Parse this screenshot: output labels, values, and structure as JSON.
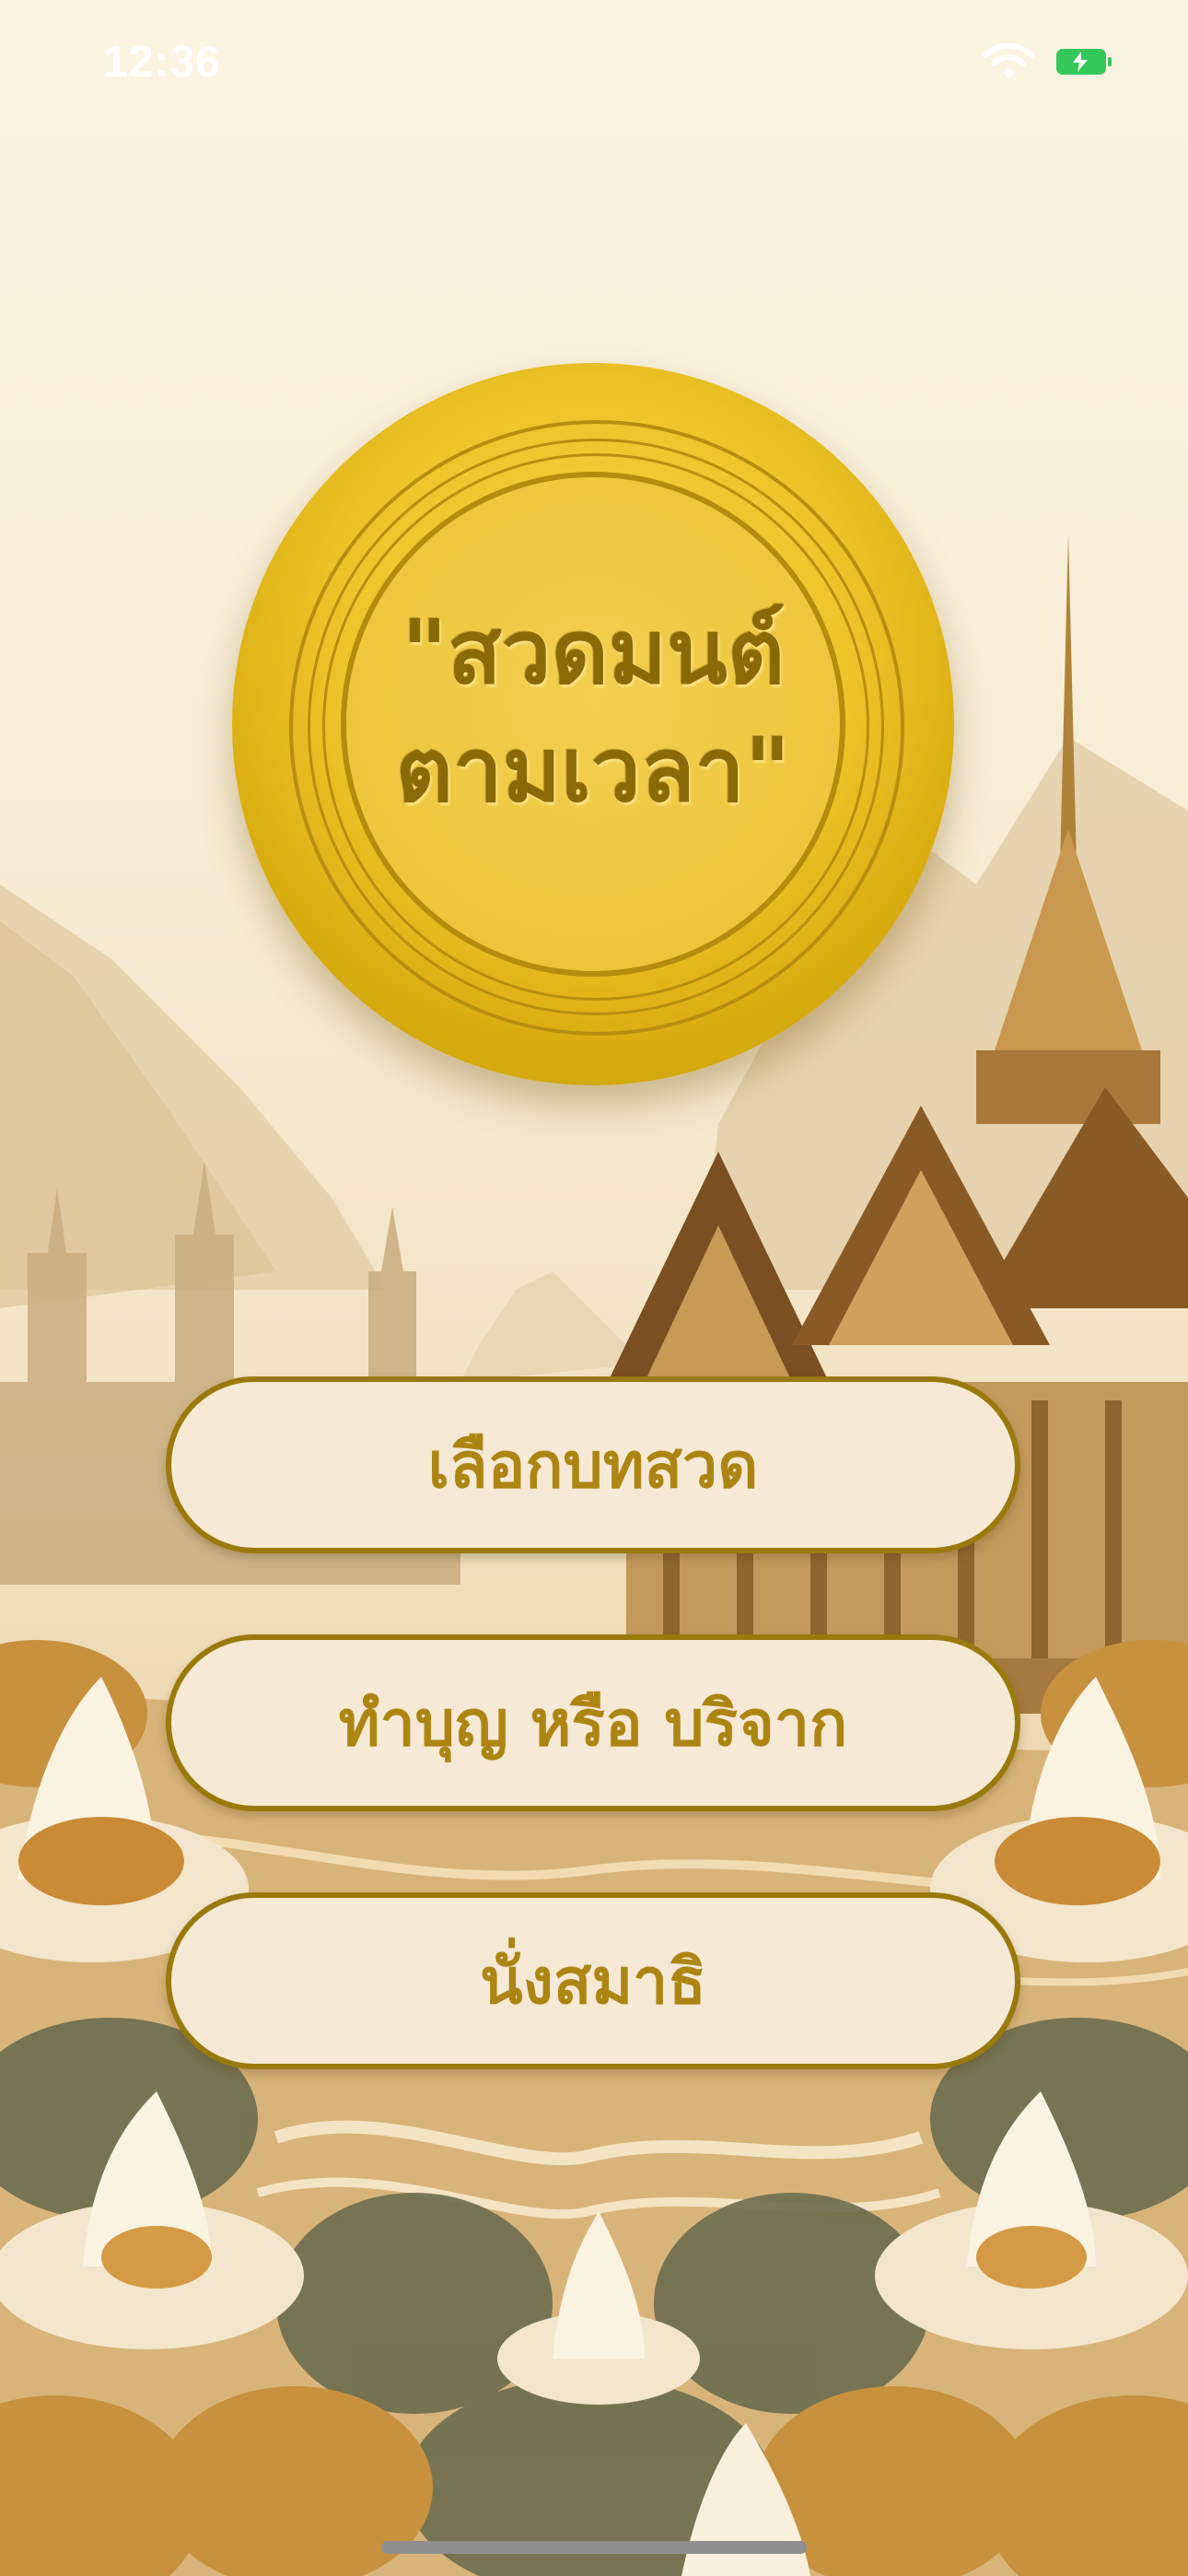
{
  "status_bar": {
    "time": "12:36",
    "wifi_icon": "wifi-icon",
    "battery_icon": "battery-charging-icon"
  },
  "header": {
    "title_line1": "\"สวดมนต์",
    "title_line2": "ตามเวลา\""
  },
  "menu": {
    "items": [
      {
        "label": "เลือกบทสวด"
      },
      {
        "label": "ทำบุญ หรือ บริจาก"
      },
      {
        "label": "นั่งสมาธิ"
      }
    ]
  },
  "colors": {
    "gold": "#edc52a",
    "gold_dark": "#8a6a06",
    "button_fill": "#f6e9d6",
    "button_border": "#9a7a0c",
    "button_text": "#ad8512"
  }
}
